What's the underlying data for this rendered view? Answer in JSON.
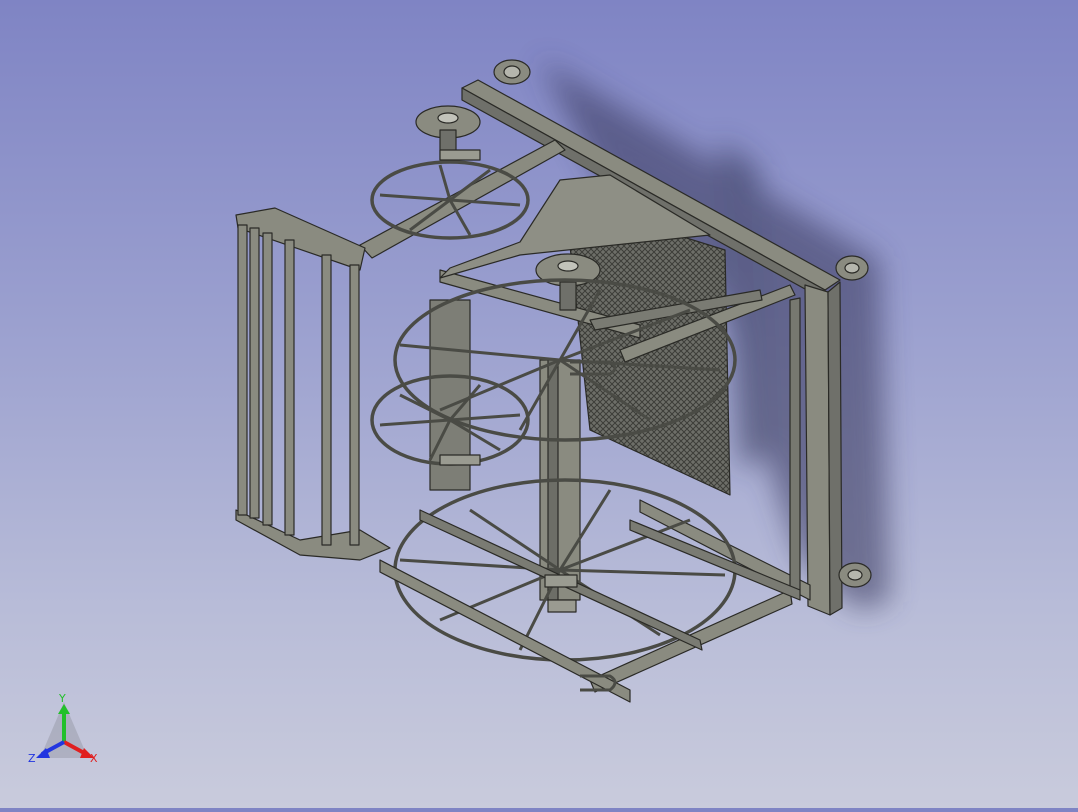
{
  "viewport": {
    "background_top": "#7f84c4",
    "background_bottom": "#c9cbdc",
    "model_color": "#8a8b80",
    "edge_color": "#2a2a26",
    "shadow_color": "#3a3a55"
  },
  "triad": {
    "x_label": "X",
    "y_label": "Y",
    "z_label": "Z",
    "x_color": "#e01f1f",
    "y_color": "#22c02a",
    "z_color": "#2235e0"
  }
}
